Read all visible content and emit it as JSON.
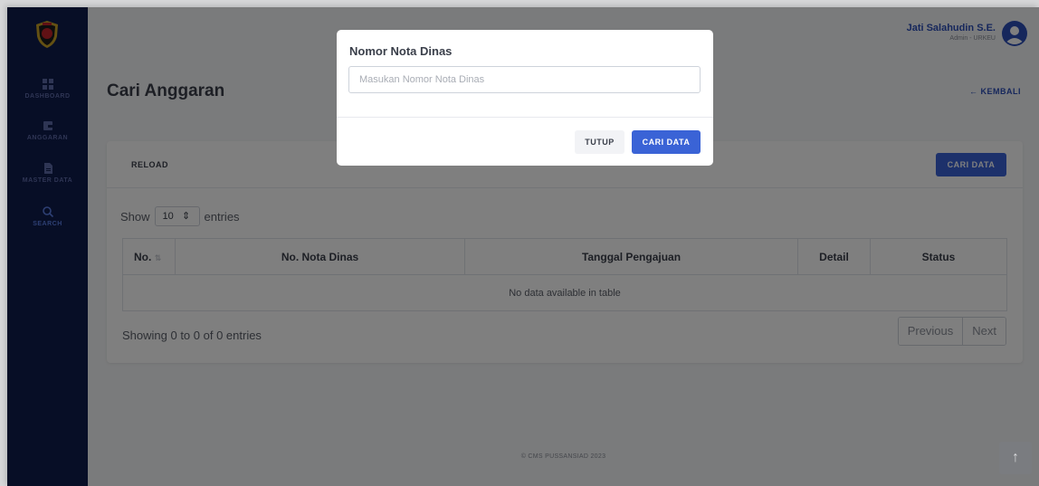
{
  "sidebar": {
    "items": [
      {
        "label": "DASHBOARD",
        "icon": "dashboard-grid-icon"
      },
      {
        "label": "ANGGARAN",
        "icon": "wallet-icon"
      },
      {
        "label": "MASTER DATA",
        "icon": "document-icon"
      },
      {
        "label": "SEARCH",
        "icon": "search-icon",
        "active": true
      }
    ]
  },
  "header": {
    "user_name": "Jati Salahudin S.E.",
    "user_role": "Admin - URKEU"
  },
  "page": {
    "title": "Cari Anggaran",
    "back_label": "← KEMBALI"
  },
  "card": {
    "reload_label": "RELOAD",
    "search_button": "CARI DATA",
    "show_label": "Show",
    "entries_value": "10",
    "entries_label": "entries",
    "columns": [
      "No.",
      "No. Nota Dinas",
      "Tanggal Pengajuan",
      "Detail",
      "Status"
    ],
    "empty_text": "No data available in table",
    "info_text": "Showing 0 to 0 of 0 entries",
    "prev_label": "Previous",
    "next_label": "Next"
  },
  "footer": {
    "text": "© CMS PUSSANSIAD 2023"
  },
  "modal": {
    "title": "Nomor Nota Dinas",
    "input_placeholder": "Masukan Nomor Nota Dinas",
    "input_value": "",
    "close_label": "TUTUP",
    "submit_label": "CARI DATA"
  },
  "scroll_top_icon": "↑",
  "colors": {
    "sidebar": "#0f1c4d",
    "accent": "#3a63d6",
    "overlay": "rgba(0,0,0,0.5)"
  }
}
